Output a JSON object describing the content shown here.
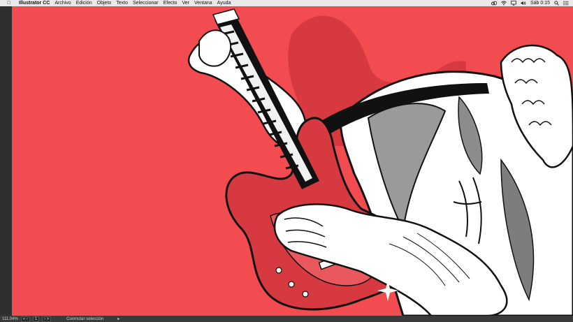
{
  "menubar": {
    "apple_icon": "apple-logo-icon",
    "app_name": "Illustrator CC",
    "items": [
      "Archivo",
      "Edición",
      "Objeto",
      "Texto",
      "Seleccionar",
      "Efecto",
      "Ver",
      "Ventana",
      "Ayuda"
    ],
    "clock": "Sáb 0:15",
    "status_icons": [
      "creative-cloud-icon",
      "wifi-icon",
      "airplay-icon",
      "volume-icon",
      "spotlight-icon",
      "notification-center-icon"
    ]
  },
  "statusbar": {
    "zoom": "111.04%",
    "artboard_number": "1",
    "mode": "Conmutar selección"
  },
  "artwork": {
    "background_color": "#f24b50",
    "accent_red": "#d63a40",
    "outline": "#111111"
  }
}
